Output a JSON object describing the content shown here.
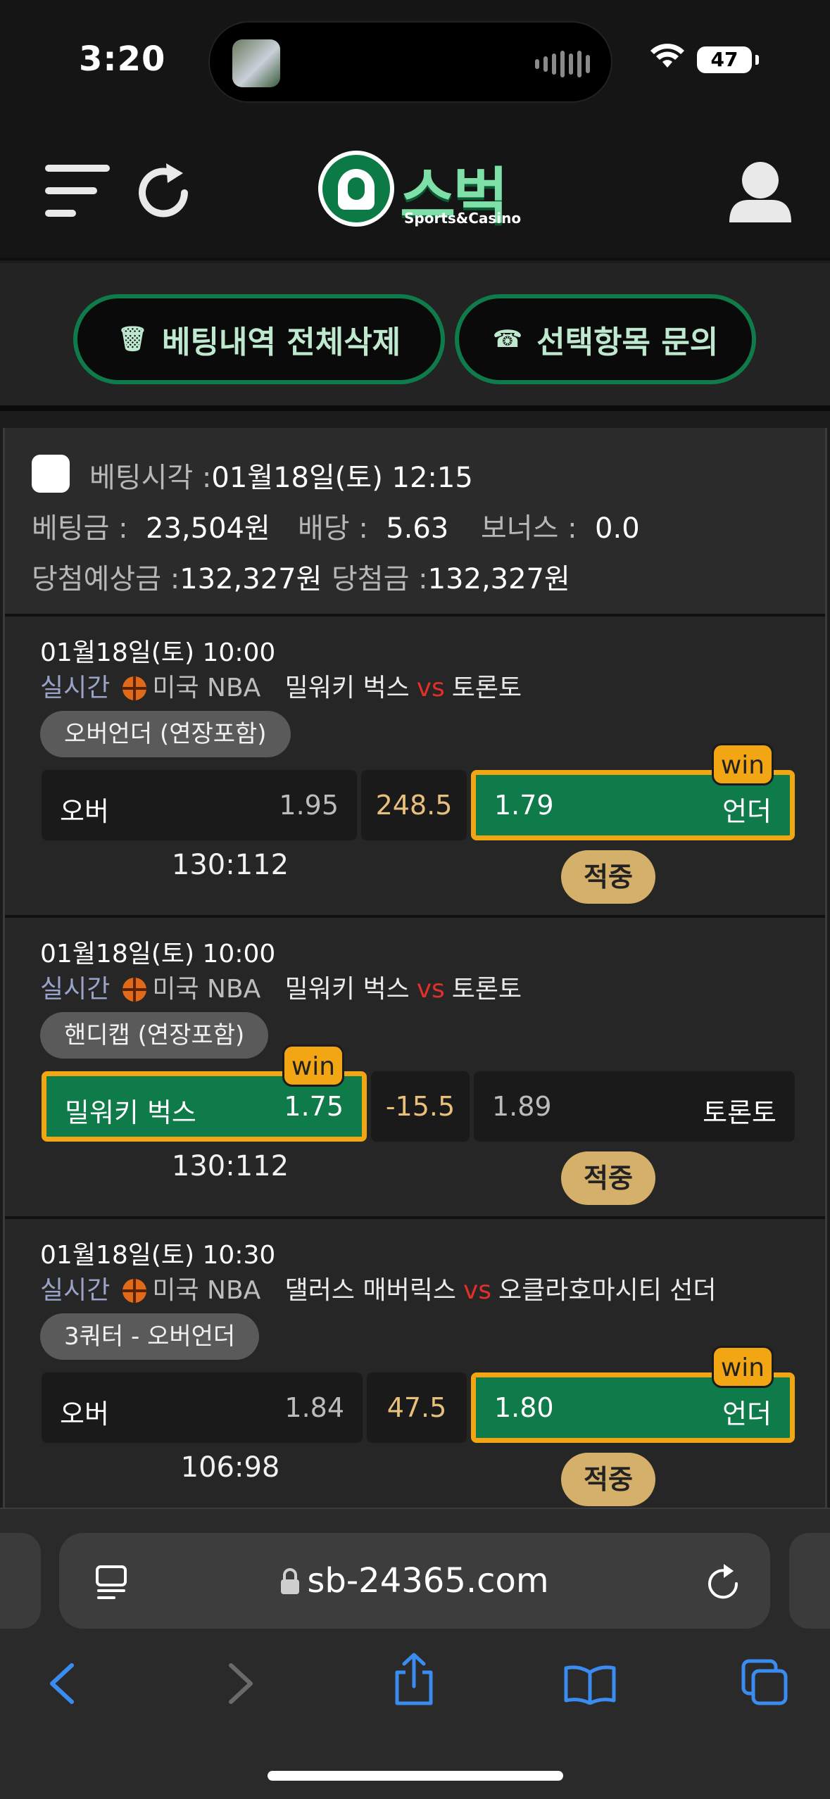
{
  "status": {
    "time": "3:20",
    "battery": "47"
  },
  "header": {
    "logo_text": "스벅",
    "logo_sub": "Sports&Casino"
  },
  "actions": {
    "delete_all": "베팅내역 전체삭제",
    "inquire": "선택항목 문의"
  },
  "summary": {
    "bet_time_label": "베팅시각 :",
    "bet_time": "01월18일(토) 12:15",
    "stake_label": "베팅금 :",
    "stake": "23,504원",
    "odds_label": "배당 :",
    "odds": "5.63",
    "bonus_label": "보너스 :",
    "bonus": "0.0",
    "expected_label": "당첨예상금 :",
    "expected": "132,327원",
    "won_label": "당첨금 :",
    "won": "132,327원"
  },
  "games": [
    {
      "date": "01월18일(토) 10:00",
      "live": "실시간",
      "league": "미국 NBA",
      "home": "밀워키 벅스",
      "vs": "vs",
      "away": "토론토",
      "market": "오버언더 (연장포함)",
      "left_name": "오버",
      "left_odds": "1.95",
      "line": "248.5",
      "right_odds": "1.79",
      "right_name": "언더",
      "win_label": "win",
      "score": "130:112",
      "result": "적중"
    },
    {
      "date": "01월18일(토) 10:00",
      "live": "실시간",
      "league": "미국 NBA",
      "home": "밀워키 벅스",
      "vs": "vs",
      "away": "토론토",
      "market": "핸디캡 (연장포함)",
      "left_name": "밀워키 벅스",
      "left_odds": "1.75",
      "line": "-15.5",
      "right_odds": "1.89",
      "right_name": "토론토",
      "win_label": "win",
      "score": "130:112",
      "result": "적중"
    },
    {
      "date": "01월18일(토) 10:30",
      "live": "실시간",
      "league": "미국 NBA",
      "home": "댈러스 매버릭스",
      "vs": "vs",
      "away": "오클라호마시티 선더",
      "market": "3쿼터 - 오버언더",
      "left_name": "오버",
      "left_odds": "1.84",
      "line": "47.5",
      "right_odds": "1.80",
      "right_name": "언더",
      "win_label": "win",
      "score": "106:98",
      "result": "적중"
    }
  ],
  "browser": {
    "url": "sb-24365.com"
  },
  "colors": {
    "accent_green": "#0f7a4a",
    "win_orange": "#f3a614",
    "hit_gold": "#d4b06a",
    "vs_red": "#e0302a"
  }
}
